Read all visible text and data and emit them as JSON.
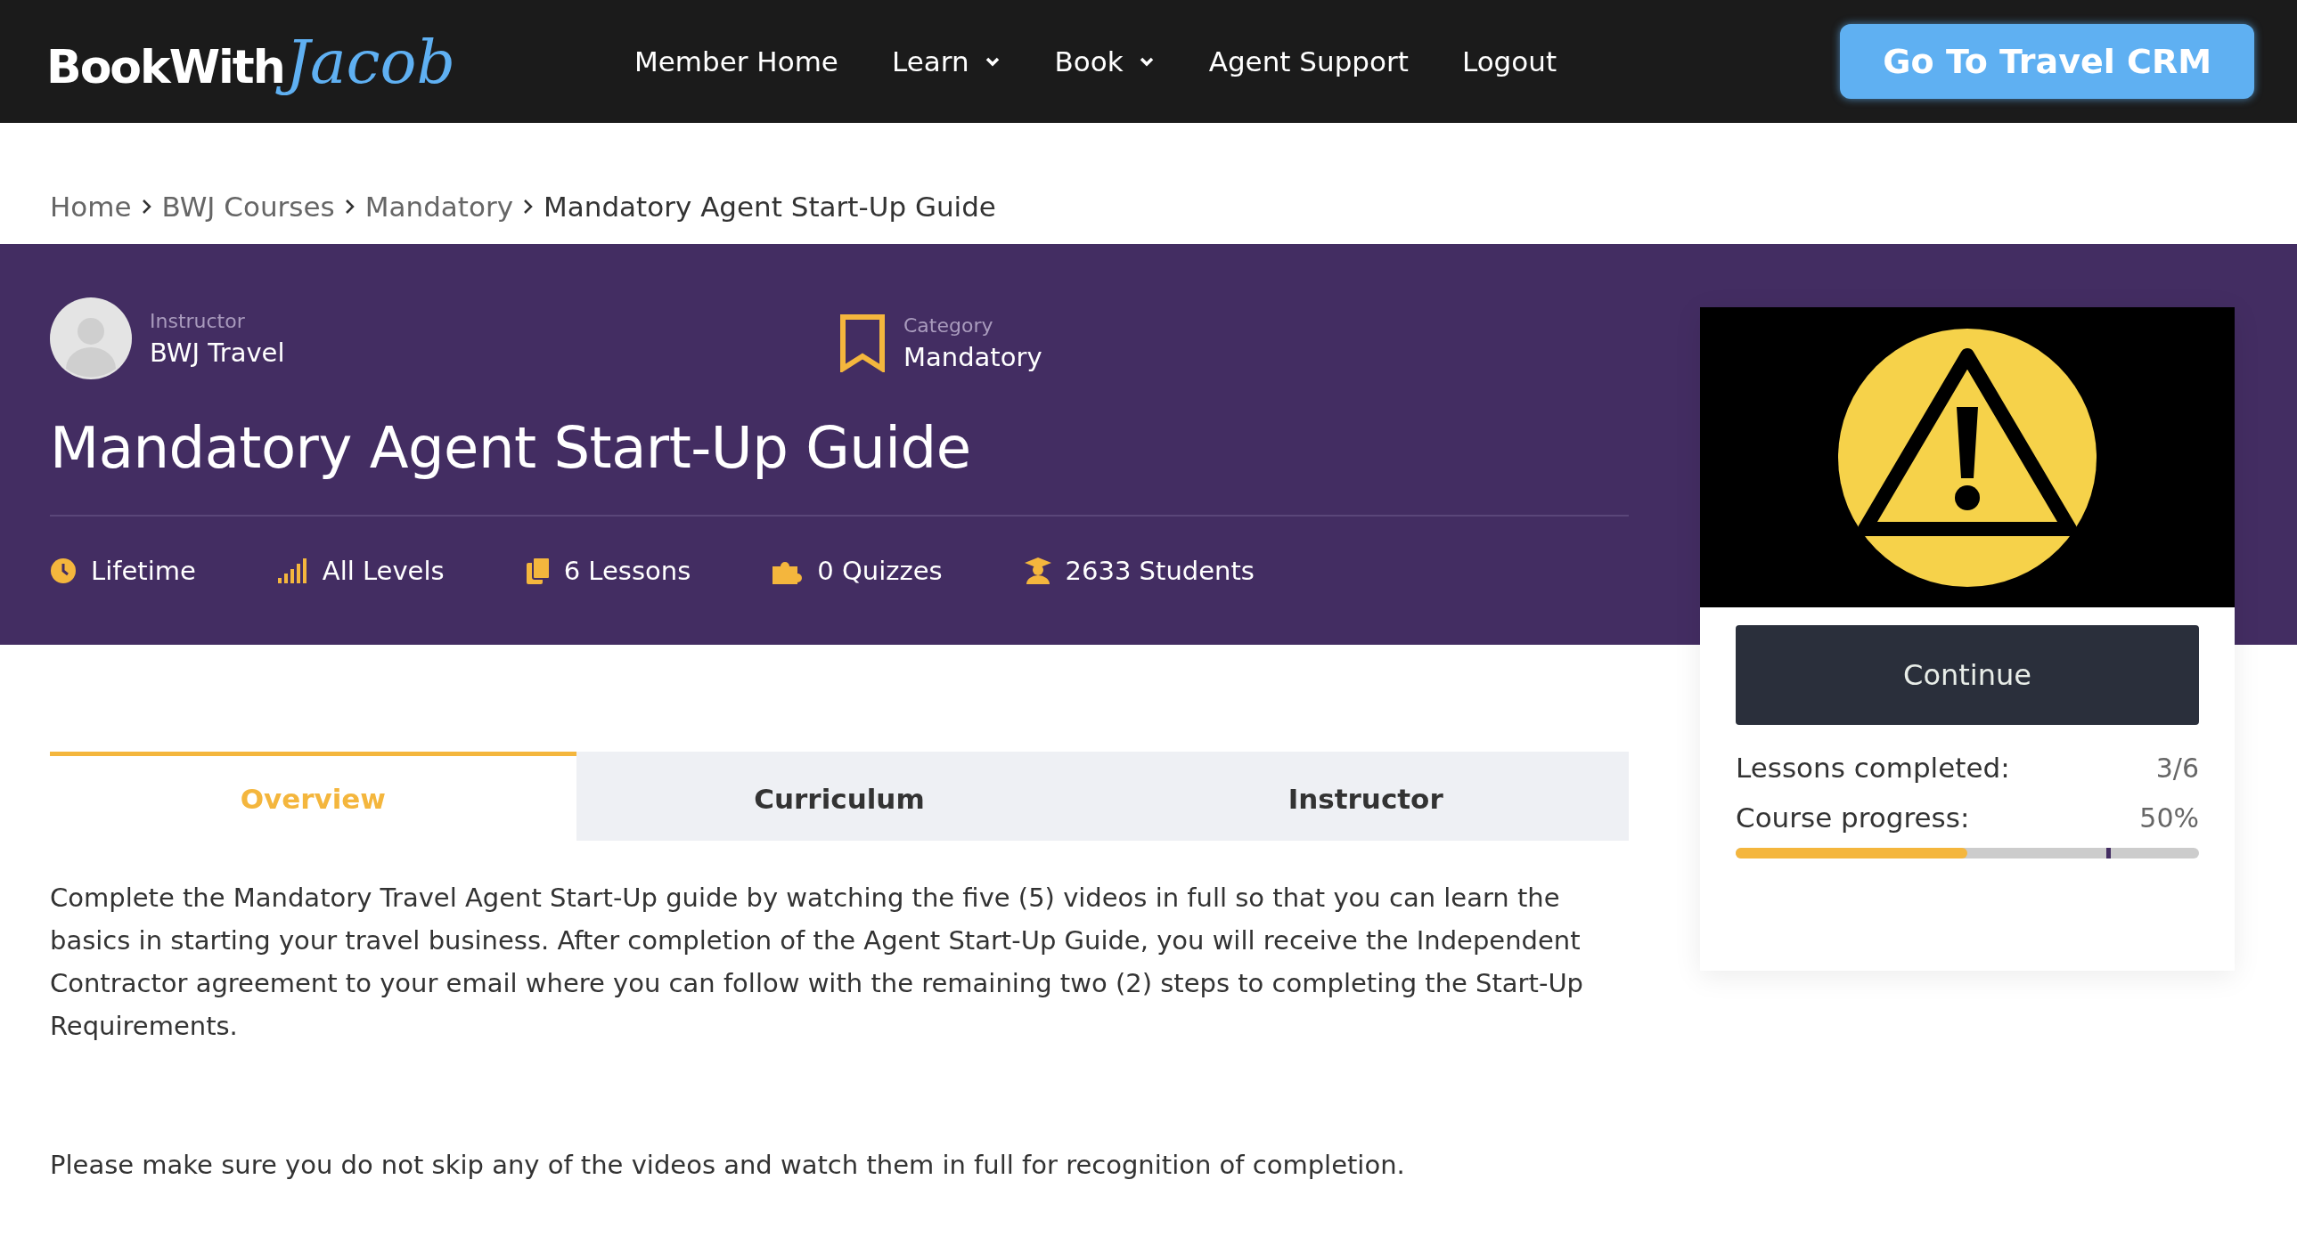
{
  "header": {
    "logo": {
      "bold": "BookWith",
      "script": "Jacob"
    },
    "nav": [
      {
        "label": "Member Home",
        "dropdown": false
      },
      {
        "label": "Learn",
        "dropdown": true
      },
      {
        "label": "Book",
        "dropdown": true
      },
      {
        "label": "Agent Support",
        "dropdown": false
      },
      {
        "label": "Logout",
        "dropdown": false
      }
    ],
    "cta": "Go To Travel CRM"
  },
  "breadcrumb": [
    "Home",
    "BWJ Courses",
    "Mandatory",
    "Mandatory Agent Start-Up Guide"
  ],
  "course": {
    "instructor": {
      "label": "Instructor",
      "name": "BWJ Travel"
    },
    "category": {
      "label": "Category",
      "name": "Mandatory"
    },
    "title": "Mandatory Agent Start-Up Guide",
    "meta": [
      {
        "kind": "clock",
        "text": "Lifetime"
      },
      {
        "kind": "levels",
        "text": "All Levels"
      },
      {
        "kind": "files",
        "text": "6 Lessons"
      },
      {
        "kind": "puzzle",
        "text": "0 Quizzes"
      },
      {
        "kind": "graduate",
        "text": "2633 Students"
      }
    ]
  },
  "tabs": [
    {
      "label": "Overview",
      "selected": true
    },
    {
      "label": "Curriculum",
      "selected": false
    },
    {
      "label": "Instructor",
      "selected": false
    }
  ],
  "overview": [
    "Complete the Mandatory Travel Agent Start-Up guide by watching the five (5) videos in full so that you can learn the basics in starting your travel business. After completion of the Agent Start-Up Guide, you will receive the Independent Contractor agreement to your email where you can follow with the remaining two (2) steps to completing the Start-Up Requirements.",
    "Please make sure you do not skip any of the videos and watch them in full for recognition of completion."
  ],
  "sidebar": {
    "button": "Continue",
    "lessons": {
      "label": "Lessons completed:",
      "value": "3/6"
    },
    "progress": {
      "label": "Course progress:",
      "value": "50%",
      "level": 0.5,
      "marker": {
        "level": 0.8
      }
    }
  }
}
